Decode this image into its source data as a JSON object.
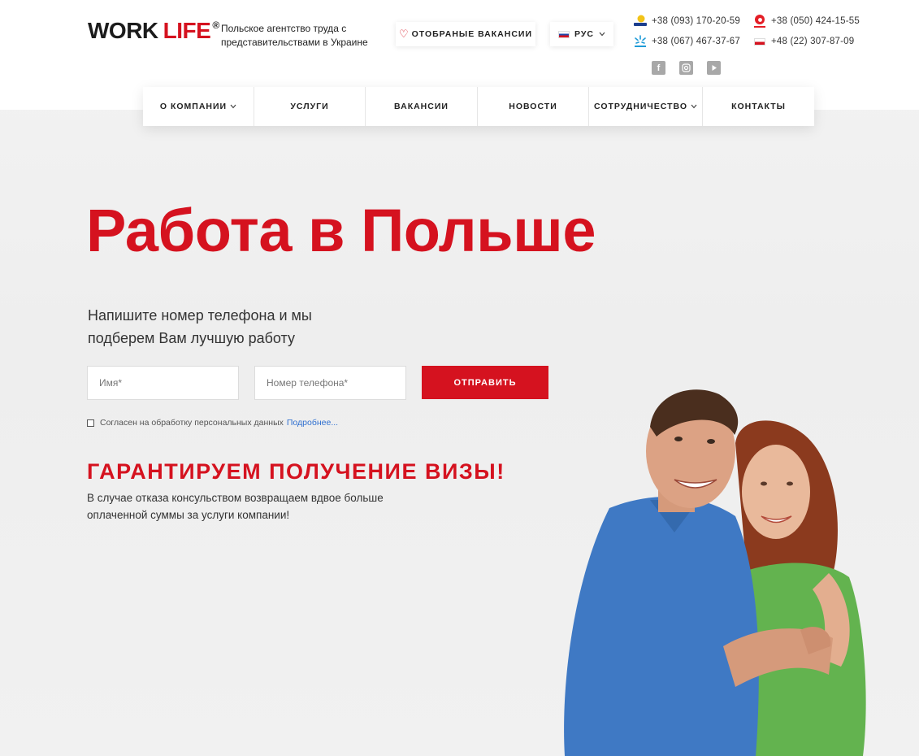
{
  "header": {
    "logo": {
      "word1": "WORK",
      "word2": "LIFE",
      "reg": "®"
    },
    "tagline": "Польское агентство труда с представительствами в Украине",
    "favorites_label": "ОТОБРАНЫЕ ВАКАНСИИ",
    "language_label": "РУС",
    "phones": {
      "lifecell": "+38 (093) 170-20-59",
      "kyivstar": "+38 (067) 467-37-67",
      "vodafone": "+38 (050) 424-15-55",
      "poland": "+48 (22) 307-87-09"
    },
    "social": [
      "facebook-icon",
      "instagram-icon",
      "youtube-icon"
    ]
  },
  "nav": {
    "items": [
      {
        "label": "О КОМПАНИИ",
        "has_dropdown": true
      },
      {
        "label": "УСЛУГИ",
        "has_dropdown": false
      },
      {
        "label": "ВАКАНСИИ",
        "has_dropdown": false
      },
      {
        "label": "НОВОСТИ",
        "has_dropdown": false
      },
      {
        "label": "СОТРУДНИЧЕСТВО",
        "has_dropdown": true
      },
      {
        "label": "КОНТАКТЫ",
        "has_dropdown": false
      }
    ]
  },
  "hero": {
    "title": "Работа в Польше",
    "subtitle": "Напишите номер телефона и мы подберем Вам лучшую работу"
  },
  "form": {
    "name_placeholder": "Имя*",
    "phone_placeholder": "Номер телефона*",
    "submit_label": "ОТПРАВИТЬ",
    "consent_text": "Согласен на обработку персональных данных",
    "consent_link": "Подробнее..."
  },
  "guarantee": {
    "title": "ГАРАНТИРУЕМ ПОЛУЧЕНИЕ ВИЗЫ!",
    "text": "В случае отказа консульством возвращаем вдвое больше оплаченной суммы за услуги компании!"
  },
  "colors": {
    "brand_red": "#d5121f",
    "link_blue": "#2f6fcf",
    "text_dark": "#222222"
  }
}
